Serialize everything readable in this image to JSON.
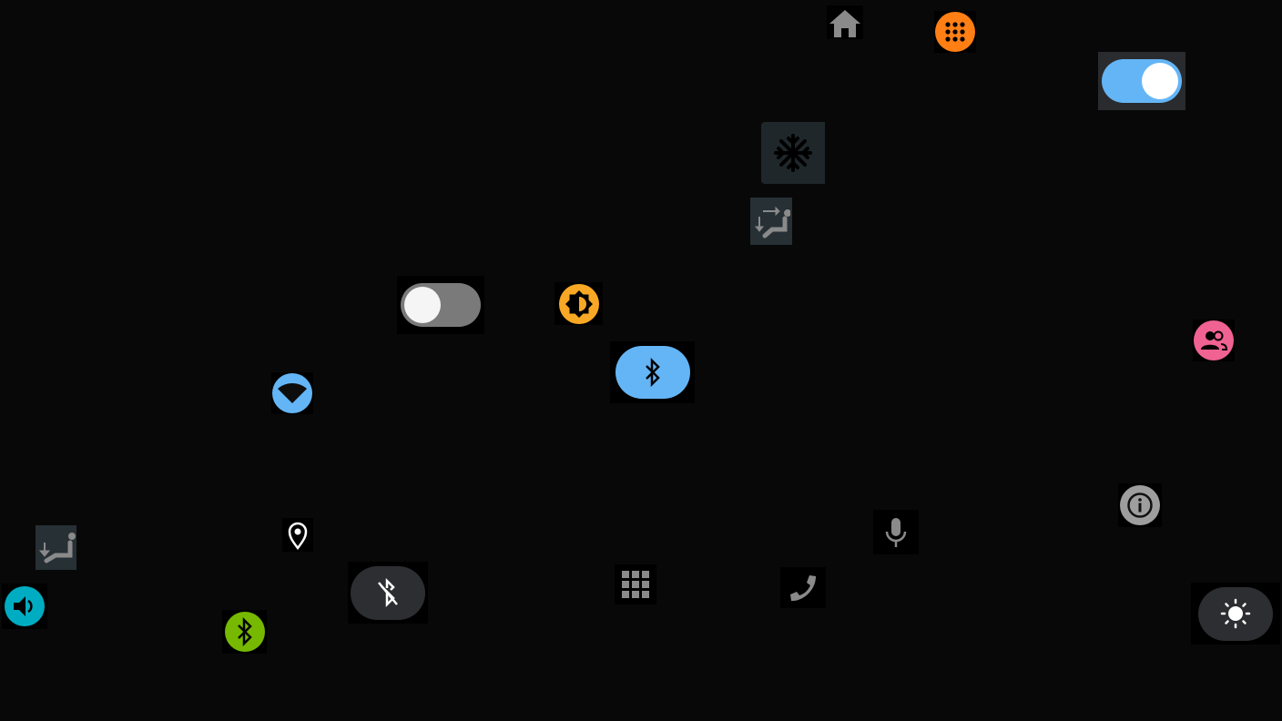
{
  "icons": {
    "home": {
      "name": "home-icon",
      "color": "#8a8a8a"
    },
    "apps": {
      "name": "apps-icon",
      "color": "#ff7f14"
    },
    "defrost": {
      "name": "snowflake-icon",
      "bg": "#1f272b"
    },
    "seat_swap": {
      "name": "seat-adjust-icon",
      "bg": "#263035"
    },
    "seat_down": {
      "name": "seat-recline-icon",
      "bg": "#263035"
    },
    "brightness_auto": {
      "name": "brightness-auto-icon",
      "color": "#f9a825"
    },
    "bluetooth_on": {
      "name": "bluetooth-icon",
      "color": "#64b5f6"
    },
    "bluetooth_off": {
      "name": "bluetooth-off-icon",
      "color": "#2d2e31"
    },
    "bluetooth_green": {
      "name": "bluetooth-icon",
      "color": "#76b900"
    },
    "people": {
      "name": "people-icon",
      "color": "#f06292"
    },
    "wifi": {
      "name": "wifi-icon",
      "color": "#64b5f6"
    },
    "info": {
      "name": "info-icon",
      "color": "#9e9e9e"
    },
    "mic": {
      "name": "mic-icon",
      "color": "#8a8a8a"
    },
    "location": {
      "name": "location-pin-icon",
      "color": "#ffffff"
    },
    "grid": {
      "name": "grid-icon",
      "color": "#8a8a8a"
    },
    "phone": {
      "name": "phone-icon",
      "color": "#8a8a8a"
    },
    "brightness": {
      "name": "brightness-icon",
      "color": "#2d2e31"
    },
    "volume": {
      "name": "volume-icon",
      "color": "#00acc1"
    }
  },
  "toggles": {
    "top_right": {
      "on": true,
      "color": "#64b5f6"
    },
    "middle": {
      "on": false,
      "color": "#7a7a7a"
    }
  }
}
